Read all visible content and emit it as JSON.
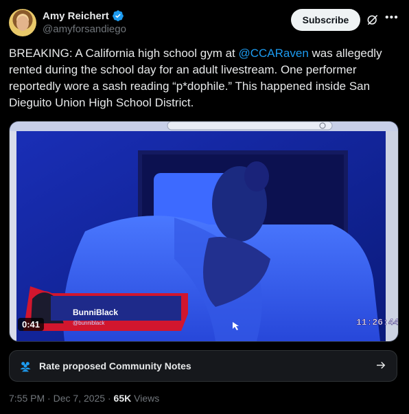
{
  "author": {
    "name": "Amy Reichert",
    "handle": "@amyforsandiego"
  },
  "header": {
    "subscribe_label": "Subscribe",
    "more_icon": "more-icon",
    "grok_icon": "grok-icon"
  },
  "post": {
    "text_part1": "BREAKING: A California high school gym at ",
    "mention": "@CCARaven",
    "text_part2": " was allegedly rented during the school day for an adult livestream. One performer reportedly wore a sash reading “p*dophile.” This happened inside San Dieguito Union High School District."
  },
  "video": {
    "duration": "0:41",
    "overlay_name": "BunniBlack",
    "overlay_handle": "@bunniblack",
    "overlay_time": "11:26:44"
  },
  "community_notes": {
    "label": "Rate proposed Community Notes"
  },
  "meta": {
    "time": "7:55 PM",
    "date": "Dec 7, 2025",
    "views_count": "65K",
    "views_label": "Views"
  },
  "colors": {
    "accent": "#1d9bf0",
    "background": "#000000"
  }
}
